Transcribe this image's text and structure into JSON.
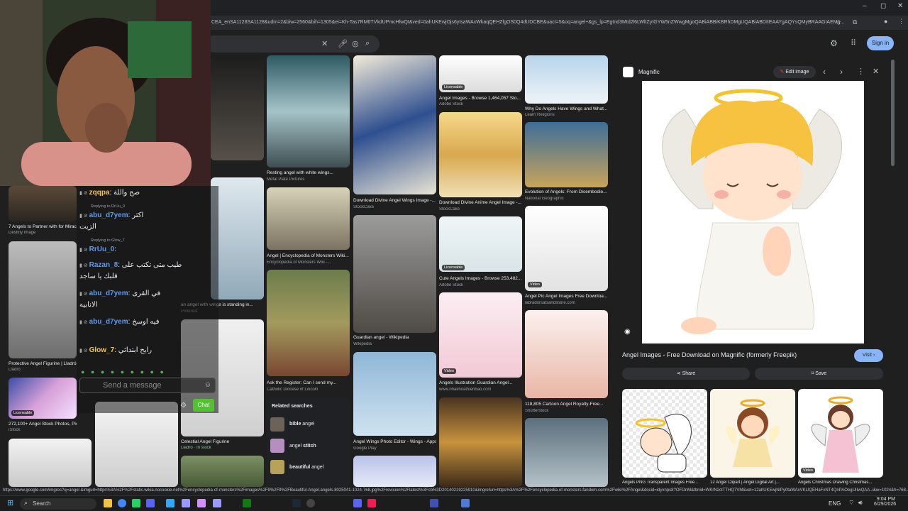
{
  "browser": {
    "url": "CEA_enSA1128SA1128&udm=2&biw=2560&bih=1305&ei=Kh-Tas7RM6TVkdUPmcHlwQI&ved=0ahUKEwjOjs6ytsaWAxWkaqQEHZlgOS0Q4dUDCBE&uact=5&oq=angel+&gs_lp=Egtnd3Mtd2l6LWltZyIGYW5nZWwgMgoQABiABBiKBRhDMgUQABiABDIIEAAYgAQYsQMyBRAAGIAEMg...",
    "signin": "Sign in"
  },
  "results": {
    "col1": [
      {
        "caption": "7 Angels to Partner with for Miracl...",
        "source": "Destiny Image"
      },
      {
        "caption": "Protective Angel Figurine | Lladró",
        "source": "Lladró"
      },
      {
        "caption": "272,100+ Angel Stock Photos, Pictures...",
        "source": "iStock",
        "badge": "Licensable"
      }
    ],
    "col2": [
      {
        "caption": "an angel with wings is standing in...",
        "source": "Pinterest"
      },
      {
        "caption": "Celestial Angel Figurine",
        "source": "Lladró · In stock"
      }
    ],
    "col3": [
      {
        "caption": "Resting angel with white wings...",
        "source": "Metal Plate Pictures"
      },
      {
        "caption": "Angel | Encyclopedia of Monsters Wiki...",
        "source": "Encyclopedia of Monsters Wiki -..."
      },
      {
        "caption": "Ask the Register: Can I send my...",
        "source": "Catholic Diocese of Lincoln"
      }
    ],
    "col4": [
      {
        "caption": "Download Divine Angel Wings Image -...",
        "source": "StockCake"
      },
      {
        "caption": "Guardian angel - Wikipedia",
        "source": "Wikipedia"
      },
      {
        "caption": "Angel Wings Photo Editor - Wings - Apps...",
        "source": "Google Play"
      }
    ],
    "col5": [
      {
        "caption": "Angel Images - Browse 1,464,057 Sto...",
        "source": "Adobe Stock",
        "badge": "Licensable"
      },
      {
        "caption": "Download Divine Anime Angel Image -...",
        "source": "StockCake"
      },
      {
        "caption": "Cute Angels Images - Browse 253,482...",
        "source": "Adobe Stock",
        "badge": "Licensable"
      },
      {
        "caption": "Angels Illustration Guardian Angel...",
        "source": "www.nhakhoathienbao.com",
        "badge": "Video"
      }
    ],
    "col6": [
      {
        "caption": "Why Do Angels Have Wings and What...",
        "source": "Learn Religions"
      },
      {
        "caption": "Evolution of Angels: From Disembodie...",
        "source": "National Geographic"
      },
      {
        "caption": "Angel Pic Angel Images Free Downloa...",
        "source": "labradorsatsandstone.com",
        "badge": "Video"
      },
      {
        "caption": "118,805 Cartoon Angel Royalty-Free...",
        "source": "Shutterstock"
      }
    ],
    "related": {
      "title": "Related searches",
      "items": [
        {
          "bold": "bible",
          "rest": " angel"
        },
        {
          "bold": "",
          "rest": "angel ",
          "tail": "stitch"
        },
        {
          "bold": "beautiful",
          "rest": " angel"
        }
      ]
    }
  },
  "chat": {
    "lines": [
      {
        "user": "zqqpa",
        "text": "صح واللة",
        "color": "#f6c344"
      },
      {
        "sub": "Replying to RrUu_0"
      },
      {
        "user": "abu_d7yem",
        "text": "اكثر",
        "color": "#5a9bf6"
      },
      {
        "text": "الزيت"
      },
      {
        "sub": "Replying to Glow_7"
      },
      {
        "user": "RrUu_0",
        "text": "",
        "color": "#5a9bf6"
      },
      {
        "user": "Razan_8",
        "text": "طيب متى تكتب على",
        "color": "#5a9bf6"
      },
      {
        "text": "قلبك يا ساجد"
      },
      {
        "user": "abu_d7yem",
        "text": "في القرى",
        "color": "#5a9bf6"
      },
      {
        "text": "الانابيه"
      },
      {
        "user": "abu_d7yem",
        "text": "فيه اوسخ",
        "color": "#5a9bf6"
      },
      {
        "user": "Glow_7",
        "text": "رايح ابتدائي",
        "color": "#f6c344"
      }
    ],
    "placeholder": "Send a message",
    "chat_button": "Chat"
  },
  "panel": {
    "site": "Magnific",
    "edit": "Edit image",
    "title": "Angel Images - Free Download on Magnific (formerly Freepik)",
    "visit": "Visit",
    "share": "Share",
    "save": "Save",
    "thumbs": [
      {
        "caption": "Angels PNG Transparent Images Free..."
      },
      {
        "caption": "12 Angel Clipart | Angel Digital Art |..."
      },
      {
        "caption": "Angels Christmas Drawing Christmas...",
        "badge": "Video"
      }
    ]
  },
  "statusbar": "https://www.google.com/imgres?q=angel &imgurl=https%3A%2F%2Fstatic.wikia.nocookie.net%2Fencyclopedia-of-monsters%2Fimages%2F9%2F9%2FBeautiful-Angel-angels-8025041-1024-768.jpg%2Frevision%2Flatest%3Fcb%3D20140219225910&imgrefurl=https%3A%2F%2Fencyclopedia-of-monsters.fandom.com%2Fwiki%2FAngel&docid=idyxnps8?OFOnM&tbnid=WKrN2ctTTHQ7VM&vet=12ahUKEwjNiPy0taWAxVKLlQEHaFxNT4QnPAOegUIIwQAA..i&w=1024&h=768...",
  "taskbar": {
    "search": "Search",
    "lang": "ENG",
    "time": "9:04 PM",
    "date": "6/29/2026"
  }
}
